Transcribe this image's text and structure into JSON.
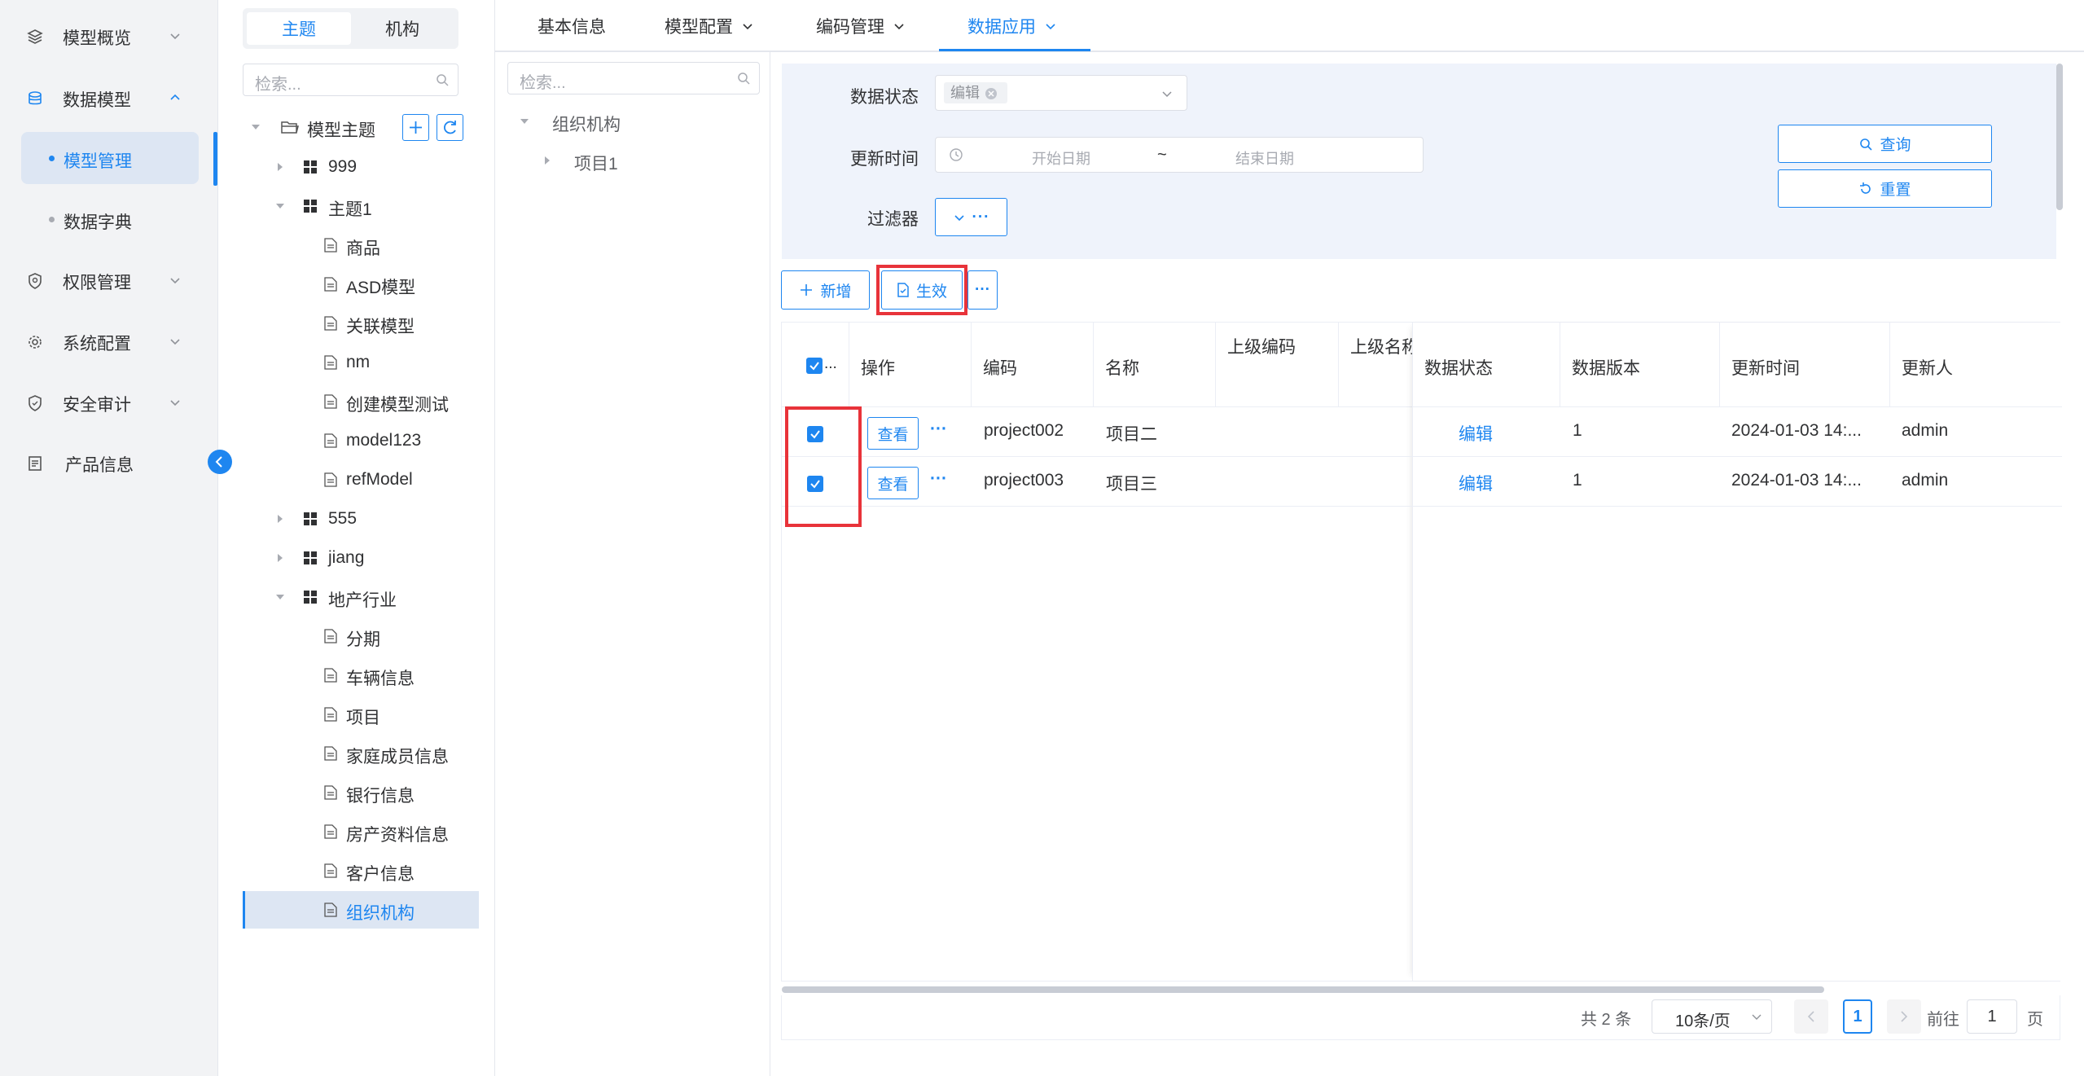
{
  "sidebar": {
    "items": [
      {
        "label": "模型概览",
        "icon": "layers-icon",
        "chevron": "down"
      },
      {
        "label": "数据模型",
        "icon": "database-icon",
        "chevron": "up"
      },
      {
        "label": "模型管理",
        "sub": true,
        "active": true
      },
      {
        "label": "数据字典",
        "sub": true
      },
      {
        "label": "权限管理",
        "icon": "shield-icon",
        "chevron": "down"
      },
      {
        "label": "系统配置",
        "icon": "gear-icon",
        "chevron": "down"
      },
      {
        "label": "安全审计",
        "icon": "security-shield-icon",
        "chevron": "down"
      },
      {
        "label": "产品信息",
        "icon": "document-icon"
      }
    ]
  },
  "segment": {
    "tabs": [
      "主题",
      "机构"
    ],
    "active": 0
  },
  "tree_search": {
    "placeholder": "检索..."
  },
  "tree": {
    "root": "模型主题",
    "nodes": [
      "999",
      "主题1",
      "商品",
      "ASD模型",
      "关联模型",
      "nm",
      "创建模型测试",
      "model123",
      "refModel",
      "555",
      "jiang",
      "地产行业",
      "分期",
      "车辆信息",
      "项目",
      "家庭成员信息",
      "银行信息",
      "房产资料信息",
      "客户信息",
      "组织机构"
    ]
  },
  "tabs": [
    {
      "label": "基本信息"
    },
    {
      "label": "模型配置"
    },
    {
      "label": "编码管理"
    },
    {
      "label": "数据应用",
      "active": true
    }
  ],
  "tree2": {
    "placeholder": "检索...",
    "root": "组织机构",
    "child": "项目1"
  },
  "filter": {
    "status_label": "数据状态",
    "status_tag": "编辑",
    "time_label": "更新时间",
    "start_placeholder": "开始日期",
    "range_sep": "~",
    "end_placeholder": "结束日期",
    "filter_label": "过滤器",
    "query_btn": "查询",
    "reset_btn": "重置"
  },
  "toolbar": {
    "add": "新增",
    "apply": "生效",
    "more": "···"
  },
  "table": {
    "headers": [
      "操作",
      "编码",
      "名称",
      "上级编码",
      "上级名称",
      "数据状态",
      "数据版本",
      "更新时间",
      "更新人"
    ],
    "check_header": "...",
    "view_label": "查看",
    "more_label": "···",
    "rows": [
      {
        "code": "project002",
        "name": "项目二",
        "status": "编辑",
        "version": "1",
        "updated": "2024-01-03 14:...",
        "user": "admin"
      },
      {
        "code": "project003",
        "name": "项目三",
        "status": "编辑",
        "version": "1",
        "updated": "2024-01-03 14:...",
        "user": "admin"
      }
    ]
  },
  "pager": {
    "total": "共 2 条",
    "size": "10条/页",
    "page": "1",
    "goto_label": "前往",
    "goto_value": "1",
    "page_suffix": "页"
  },
  "colors": {
    "primary": "#1e86f0",
    "highlight": "#e8333a",
    "sidebar_bg": "#f2f3f5",
    "filter_bg": "#eff3fb"
  }
}
